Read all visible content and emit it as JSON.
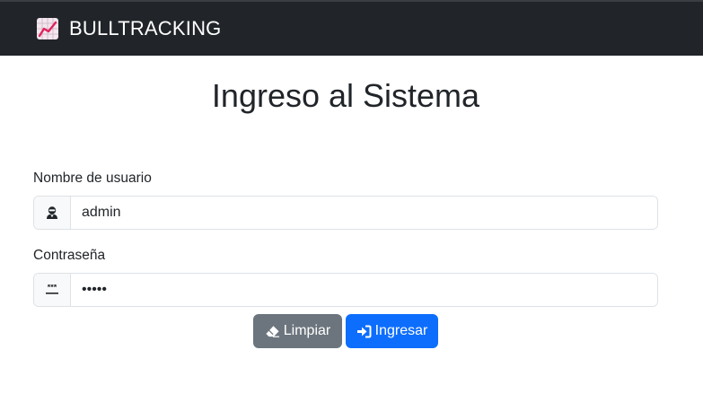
{
  "navbar": {
    "brand": "BULLTRACKING",
    "brand_icon": "chart-increasing-icon"
  },
  "page": {
    "title": "Ingreso al Sistema"
  },
  "form": {
    "username": {
      "label": "Nombre de usuario",
      "value": "admin",
      "icon": "user-ninja-icon"
    },
    "password": {
      "label": "Contraseña",
      "value": "•••••",
      "icon": "password-dots-icon"
    }
  },
  "buttons": {
    "clear": {
      "label": "Limpiar",
      "icon": "eraser-icon",
      "color": "#6c757d"
    },
    "login": {
      "label": "Ingresar",
      "icon": "sign-in-icon",
      "color": "#0d6efd"
    }
  },
  "colors": {
    "navbar_bg": "#212529",
    "primary": "#0d6efd",
    "secondary": "#6c757d"
  }
}
